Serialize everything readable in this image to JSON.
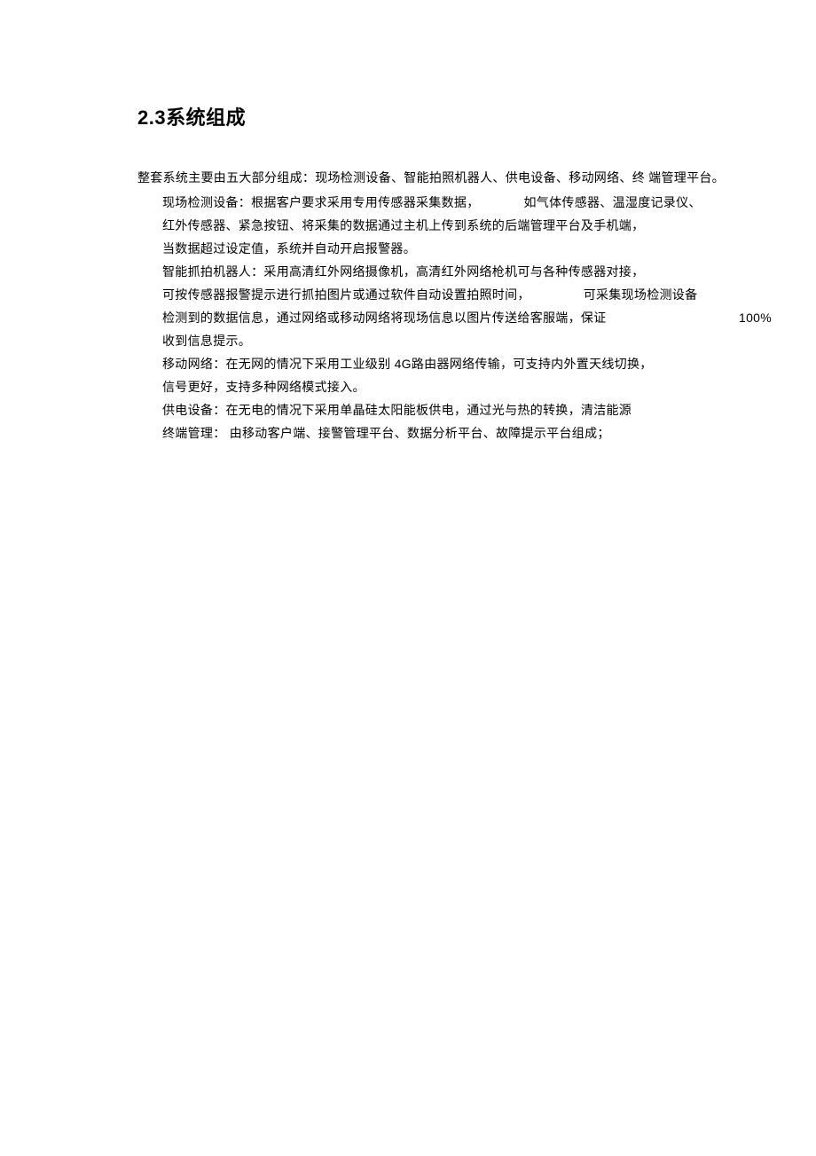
{
  "heading": "2.3系统组成",
  "intro": "整套系统主要由五大部分组成：现场检测设备、智能拍照机器人、供电设备、移动网络、终 端管理平台。",
  "lines": {
    "l1a": "现场检测设备：根据客户要求采用专用传感器采集数据，",
    "l1b": "如气体传感器、温湿度记录仪、",
    "l2": "红外传感器、紧急按钮、将采集的数据通过主机上传到系统的后端管理平台及手机端，",
    "l3": "当数据超过设定值，系统并自动开启报警器。",
    "l4": "智能抓拍机器人：采用高清红外网络摄像机，高清红外网络枪机可与各种传感器对接，",
    "l5a": "可按传感器报警提示进行抓拍图片或通过软件自动设置拍照时间，",
    "l5b": "可采集现场检测设备",
    "l6a": "检测到的数据信息，通过网络或移动网络将现场信息以图片传送给客服端，保证",
    "l6b": "100%",
    "l7": "收到信息提示。",
    "l8a": "移动网络：在无网的情况下采用工业级别 ",
    "l8n": "4G",
    "l8b": "路由器网络传输，可支持内外置天线切换，",
    "l9": "信号更好，支持多种网络模式接入。",
    "l10": "供电设备：在无电的情况下采用单晶硅太阳能板供电，通过光与热的转换，清洁能源",
    "l11": "终端管理： 由移动客户端、接警管理平台、数据分析平台、故障提示平台组成；"
  }
}
